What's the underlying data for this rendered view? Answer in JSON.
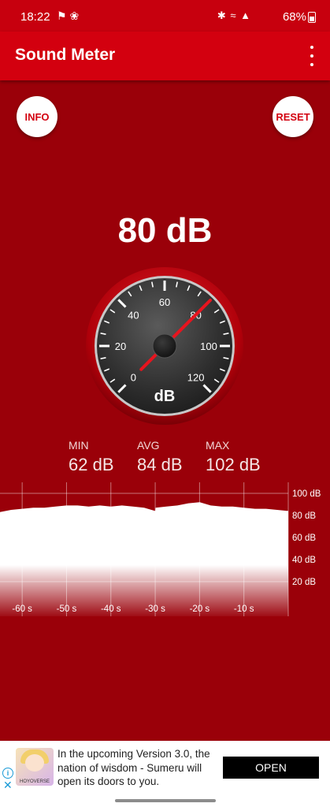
{
  "status_bar": {
    "time": "18:22",
    "battery": "68%",
    "left_icons": [
      "puzzle-icon",
      "fan-icon"
    ],
    "right_icons": [
      "bluetooth-icon",
      "wifi-icon",
      "signal-icon",
      "battery-icon"
    ]
  },
  "app_bar": {
    "title": "Sound Meter",
    "menu_icon": "more-vert-icon"
  },
  "buttons": {
    "info": "INFO",
    "reset": "RESET"
  },
  "readout": {
    "value": "80 dB"
  },
  "gauge": {
    "unit": "dB",
    "tick_labels": [
      "0",
      "20",
      "40",
      "60",
      "80",
      "100",
      "120"
    ],
    "needle_value": 80,
    "min": 0,
    "max": 120
  },
  "stats": {
    "min": {
      "label": "MIN",
      "value": "62 dB"
    },
    "avg": {
      "label": "AVG",
      "value": "84 dB"
    },
    "max": {
      "label": "MAX",
      "value": "102 dB"
    }
  },
  "chart_data": {
    "type": "area",
    "x_ticks": [
      "-60 s",
      "-50 s",
      "-40 s",
      "-30 s",
      "-20 s",
      "-10 s"
    ],
    "y_ticks": [
      "100 dB",
      "80 dB",
      "60 dB",
      "40 dB",
      "20 dB"
    ],
    "xlim": [
      -65,
      0
    ],
    "ylim": [
      10,
      110
    ],
    "grid": true,
    "series": [
      {
        "x": [
          -65,
          -62.5,
          -60,
          -57.5,
          -55,
          -52.5,
          -50,
          -47.5,
          -45,
          -42.5,
          -40,
          -37.5,
          -35,
          -32.5,
          -30,
          -29.9,
          -27.5,
          -25,
          -22.5,
          -20,
          -17.5,
          -15,
          -12.5,
          -10,
          -7.5,
          -5,
          -2.5,
          0
        ],
        "values": [
          83,
          85,
          86,
          87,
          87,
          88,
          89,
          89,
          88,
          89,
          88,
          89,
          88,
          87,
          84,
          87,
          88,
          89,
          91,
          92,
          89,
          88,
          88,
          87,
          86,
          86,
          85,
          84
        ]
      }
    ]
  },
  "ad": {
    "text": "In the upcoming Version 3.0, the nation of wisdom - Sumeru will open its doors to you.",
    "cta": "OPEN",
    "brand": "HOYOVERSE",
    "info_icon": "ad-info-icon",
    "close_icon": "ad-close-icon"
  }
}
